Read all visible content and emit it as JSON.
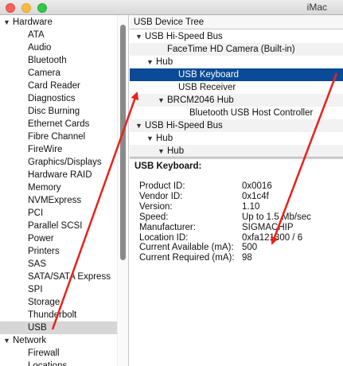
{
  "window": {
    "title": "iMac"
  },
  "sidebar": {
    "rows": [
      {
        "kind": "group",
        "label": "Hardware",
        "expanded": true
      },
      {
        "kind": "item",
        "label": "ATA"
      },
      {
        "kind": "item",
        "label": "Audio"
      },
      {
        "kind": "item",
        "label": "Bluetooth"
      },
      {
        "kind": "item",
        "label": "Camera"
      },
      {
        "kind": "item",
        "label": "Card Reader"
      },
      {
        "kind": "item",
        "label": "Diagnostics"
      },
      {
        "kind": "item",
        "label": "Disc Burning"
      },
      {
        "kind": "item",
        "label": "Ethernet Cards"
      },
      {
        "kind": "item",
        "label": "Fibre Channel"
      },
      {
        "kind": "item",
        "label": "FireWire"
      },
      {
        "kind": "item",
        "label": "Graphics/Displays"
      },
      {
        "kind": "item",
        "label": "Hardware RAID"
      },
      {
        "kind": "item",
        "label": "Memory"
      },
      {
        "kind": "item",
        "label": "NVMExpress"
      },
      {
        "kind": "item",
        "label": "PCI"
      },
      {
        "kind": "item",
        "label": "Parallel SCSI"
      },
      {
        "kind": "item",
        "label": "Power"
      },
      {
        "kind": "item",
        "label": "Printers"
      },
      {
        "kind": "item",
        "label": "SAS"
      },
      {
        "kind": "item",
        "label": "SATA/SATA Express"
      },
      {
        "kind": "item",
        "label": "SPI"
      },
      {
        "kind": "item",
        "label": "Storage"
      },
      {
        "kind": "item",
        "label": "Thunderbolt"
      },
      {
        "kind": "item",
        "label": "USB",
        "selected": true
      },
      {
        "kind": "group",
        "label": "Network",
        "expanded": true
      },
      {
        "kind": "item",
        "label": "Firewall"
      },
      {
        "kind": "item",
        "label": "Locations"
      }
    ]
  },
  "tree": {
    "header": "USB Device Tree",
    "rows": [
      {
        "label": "USB Hi-Speed Bus",
        "level": 0,
        "expandable": true
      },
      {
        "label": "FaceTime HD Camera (Built-in)",
        "level": 2,
        "expandable": false
      },
      {
        "label": "Hub",
        "level": 1,
        "expandable": true
      },
      {
        "label": "USB Keyboard",
        "level": 3,
        "expandable": false,
        "selected": true
      },
      {
        "label": "USB Receiver",
        "level": 3,
        "expandable": false
      },
      {
        "label": "BRCM2046 Hub",
        "level": 2,
        "expandable": true
      },
      {
        "label": "Bluetooth USB Host Controller",
        "level": 4,
        "expandable": false
      },
      {
        "label": "USB Hi-Speed Bus",
        "level": 0,
        "expandable": true
      },
      {
        "label": "Hub",
        "level": 1,
        "expandable": true
      },
      {
        "label": "Hub",
        "level": 2,
        "expandable": true
      }
    ]
  },
  "detail": {
    "title": "USB Keyboard:",
    "properties": [
      {
        "label": "Product ID:",
        "value": "0x0016"
      },
      {
        "label": "Vendor ID:",
        "value": "0x1c4f"
      },
      {
        "label": "Version:",
        "value": "1.10"
      },
      {
        "label": "Speed:",
        "value": "Up to 1.5 Mb/sec"
      },
      {
        "label": "Manufacturer:",
        "value": "SIGMACHIP"
      },
      {
        "label": "Location ID:",
        "value": "0xfa121300 / 6"
      },
      {
        "label": "Current Available (mA):",
        "value": "500"
      },
      {
        "label": "Current Required (mA):",
        "value": "98"
      }
    ]
  },
  "colors": {
    "selection": "#0a4a97",
    "annotation_arrow": "#e8221b"
  }
}
